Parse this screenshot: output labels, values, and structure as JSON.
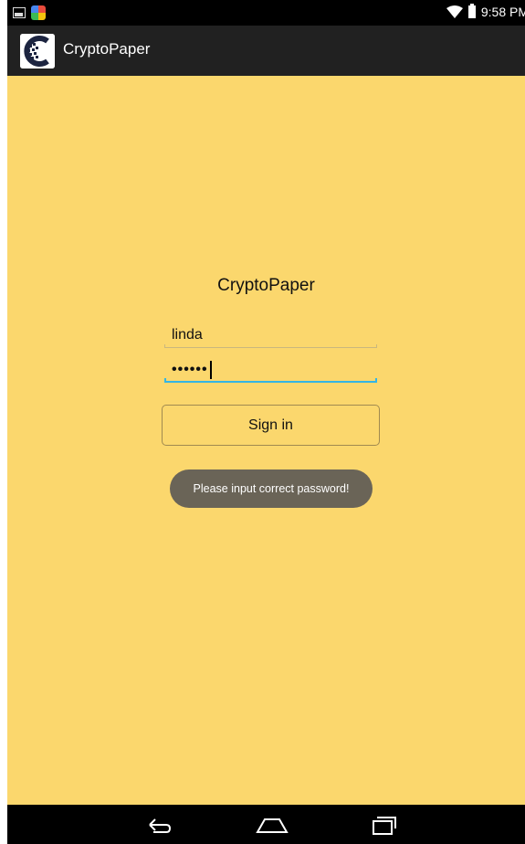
{
  "status_bar": {
    "time": "9:58 PM",
    "icons": [
      "picture-icon",
      "app-icon",
      "wifi-icon",
      "battery-icon"
    ]
  },
  "action_bar": {
    "title": "CryptoPaper",
    "logo": "cryptopaper-logo-icon"
  },
  "form": {
    "title": "CryptoPaper",
    "username_value": "linda",
    "password_value": "••••••",
    "sign_in_label": "Sign in"
  },
  "toast": {
    "message": "Please input correct password!"
  },
  "nav_bar": {
    "icons": [
      "back-icon",
      "home-icon",
      "recent-apps-icon"
    ]
  },
  "colors": {
    "background": "#fbd76d",
    "action_bar": "#212121",
    "focus_accent": "#33b5e5",
    "toast": "#6a6457"
  }
}
